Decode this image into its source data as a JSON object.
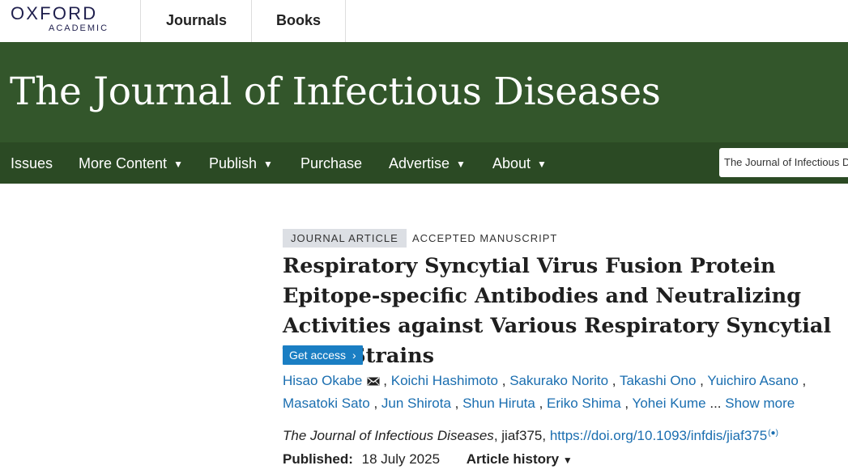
{
  "header": {
    "logo_main": "OXFORD",
    "logo_sub": "ACADEMIC",
    "nav": [
      "Journals",
      "Books"
    ]
  },
  "banner": {
    "title": "The Journal of Infectious Diseases"
  },
  "mainnav": {
    "items": [
      "Issues",
      "More Content",
      "Publish",
      "Purchase",
      "Advertise",
      "About"
    ],
    "search_value": "The Journal of Infectious D"
  },
  "article": {
    "type_badge": "JOURNAL ARTICLE",
    "status": "ACCEPTED MANUSCRIPT",
    "title": "Respiratory Syncytial Virus Fusion Protein Epitope-specific Antibodies and Neutralizing Activities against Various Respiratory Syncytial Virus Strains",
    "access_label": "Get access",
    "authors": [
      "Hisao Okabe",
      "Koichi Hashimoto",
      "Sakurako Norito",
      "Takashi Ono",
      "Yuichiro Asano",
      "Masatoki Sato",
      "Jun Shirota",
      "Shun Hiruta",
      "Eriko Shima",
      "Yohei Kume"
    ],
    "ellipsis": "...",
    "show_more": "Show more",
    "journal_name": "The Journal of Infectious Diseases",
    "article_id": ", jiaf375, ",
    "doi": "https://doi.org/10.1093/infdis/jiaf375",
    "published_label": "Published:",
    "published_date": "18 July 2025",
    "history_label": "Article history"
  },
  "colors": {
    "banner": "#33562b",
    "nav": "#2b4a24",
    "link": "#1a6eb0",
    "access_button": "#1a7ec3"
  },
  "icons": [
    "mail-icon",
    "caret-down-icon",
    "chevron-right-icon",
    "altmetric-icon"
  ]
}
